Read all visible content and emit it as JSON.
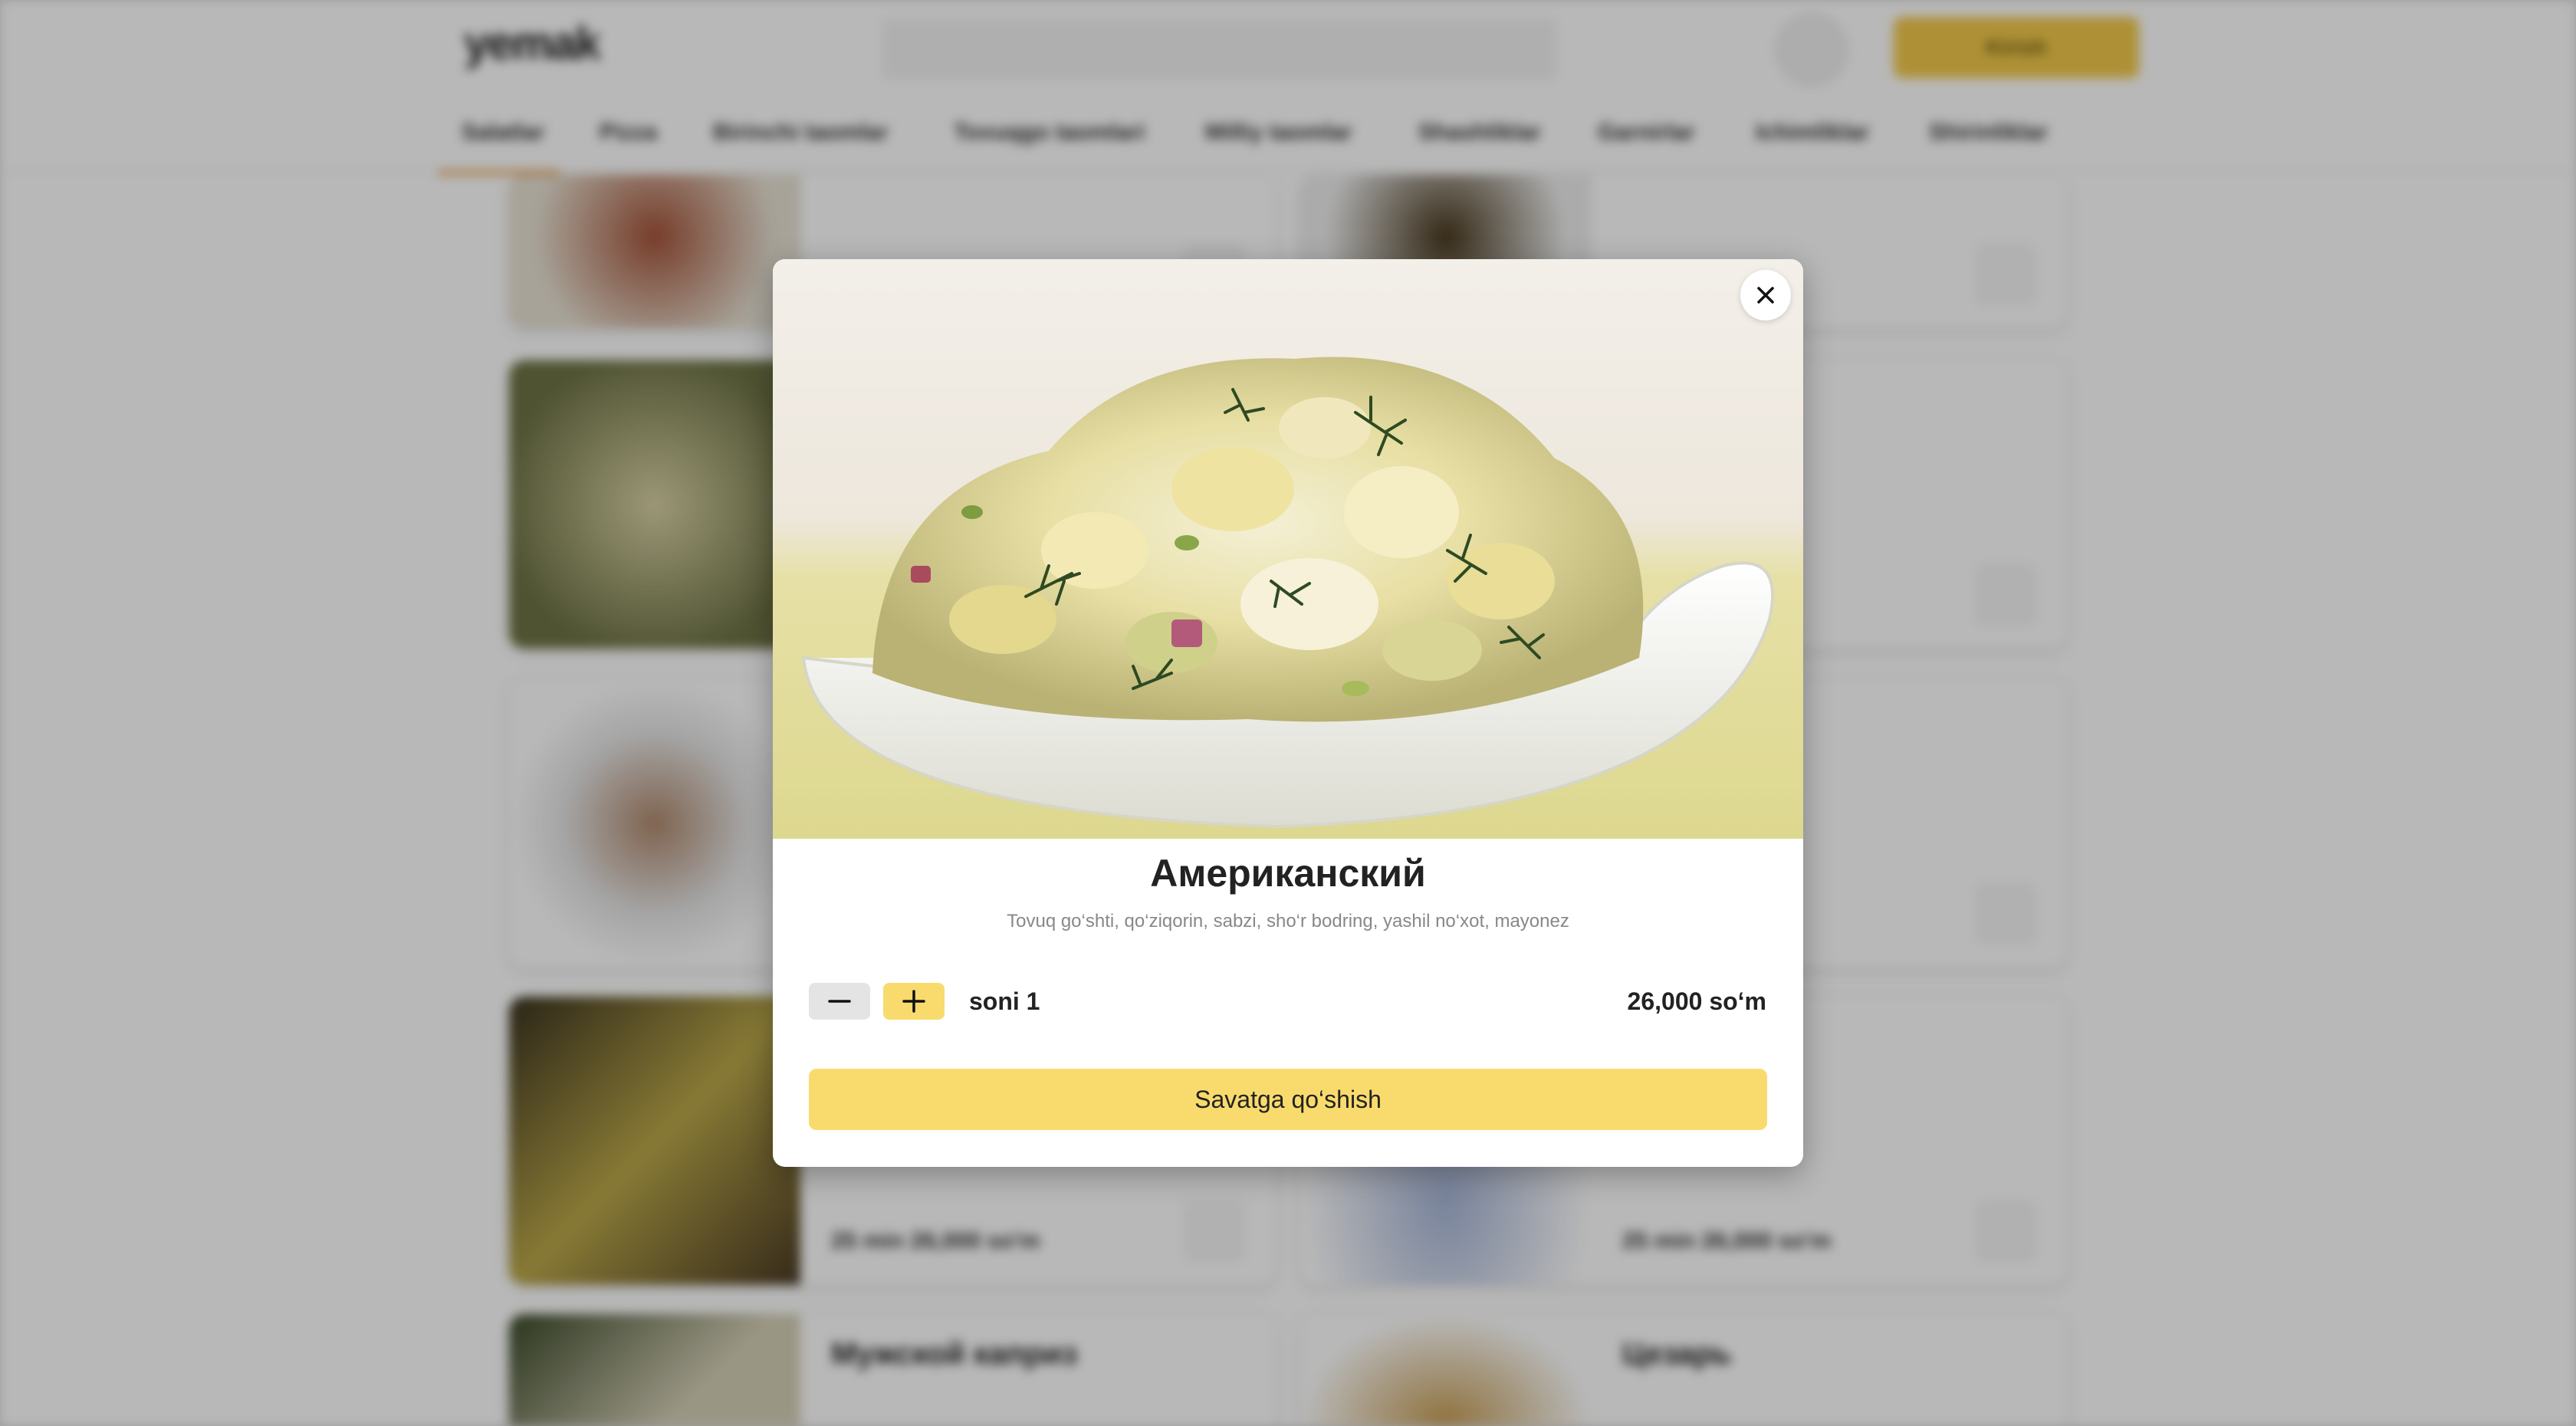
{
  "header": {
    "logo": "yemak",
    "login_label": "Kirish"
  },
  "categories": [
    "Salatlar",
    "Pizza",
    "Birinchi taomlar",
    "Tovuqgo taomlari",
    "Milliy taomlar",
    "Shashliklar",
    "Garnirlar",
    "Ichimliklar",
    "Shirinliklar"
  ],
  "background_cards": [
    {
      "title": "",
      "price": "25 min  26,000 so'm"
    },
    {
      "title": "",
      "price": "25 min  26,000 so'm"
    },
    {
      "title": "Мужской каприз",
      "price": ""
    },
    {
      "title": "Цезарь",
      "price": ""
    }
  ],
  "modal": {
    "title": "Американский",
    "description": "Tovuq go‘shti, qo‘ziqorin, sabzi, sho‘r bodring, yashil no‘xot, mayonez",
    "quantity_prefix": "soni",
    "quantity": "1",
    "price": "26,000 so‘m",
    "add_to_cart_label": "Savatga qo‘shish"
  },
  "colors": {
    "accent": "#f9db6d",
    "overlay": "rgba(0,0,0,0.28)"
  }
}
